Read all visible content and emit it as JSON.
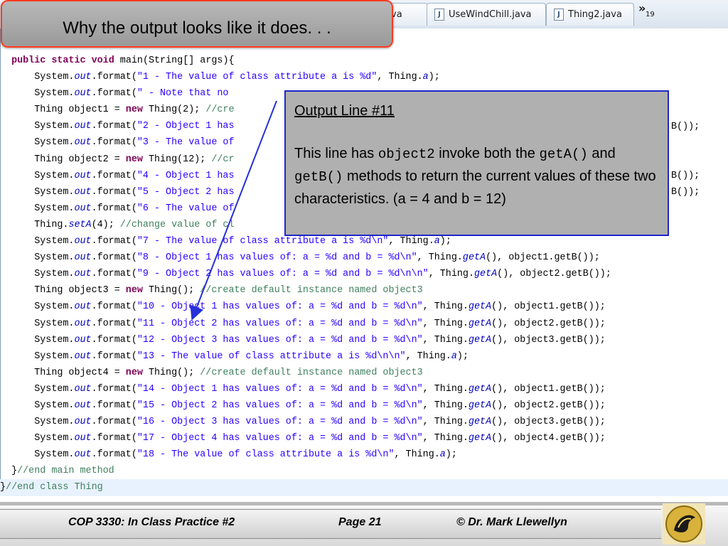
{
  "window": {
    "tabs": [
      {
        "label": "va"
      },
      {
        "label": "UseWindChill.java"
      },
      {
        "label": "Thing2.java"
      }
    ],
    "tab_overflow_count": "19"
  },
  "slide": {
    "title": "Why the output looks like it does. . ."
  },
  "callout": {
    "heading": "Output Line #11",
    "body": {
      "p1": "This line has ",
      "code1": "object2",
      "p2": " invoke both the ",
      "code2": "getA()",
      "p3": " and ",
      "code3": "getB()",
      "p4": " methods  to return the current values of these two characteristics. (a = 4 and b = 12)"
    }
  },
  "code_lines": [
    "  public static void main(String[] args){",
    "      System.out.format(\"1 - The value of class attribute a is %d\", Thing.a);",
    "      System.out.format(\" - Note that no",
    "      Thing object1 = new Thing(2); //cre",
    "      System.out.format(\"2 - Object 1 has",
    "      System.out.format(\"3 - The value of",
    "      Thing object2 = new Thing(12); //cr",
    "      System.out.format(\"4 - Object 1 has",
    "      System.out.format(\"5 - Object 2 has",
    "      System.out.format(\"6 - The value of",
    "      Thing.setA(4); //change value of cl",
    "      System.out.format(\"7 - The value of class attribute a is %d\\n\", Thing.a);",
    "      System.out.format(\"8 - Object 1 has values of: a = %d and b = %d\\n\", Thing.getA(), object1.getB());",
    "      System.out.format(\"9 - Object 2 has values of: a = %d and b = %d\\n\\n\", Thing.getA(), object2.getB());",
    "      Thing object3 = new Thing(); //create default instance named object3",
    "      System.out.format(\"10 - Object 1 has values of: a = %d and b = %d\\n\", Thing.getA(), object1.getB());",
    "      System.out.format(\"11 - Object 2 has values of: a = %d and b = %d\\n\", Thing.getA(), object2.getB());",
    "      System.out.format(\"12 - Object 3 has values of: a = %d and b = %d\\n\", Thing.getA(), object3.getB());",
    "      System.out.format(\"13 - The value of class attribute a is %d\\n\\n\", Thing.a);",
    "      Thing object4 = new Thing(); //create default instance named object3",
    "      System.out.format(\"14 - Object 1 has values of: a = %d and b = %d\\n\", Thing.getA(), object1.getB());",
    "      System.out.format(\"15 - Object 2 has values of: a = %d and b = %d\\n\", Thing.getA(), object2.getB());",
    "      System.out.format(\"16 - Object 3 has values of: a = %d and b = %d\\n\", Thing.getA(), object3.getB());",
    "      System.out.format(\"17 - Object 4 has values of: a = %d and b = %d\\n\", Thing.getA(), object4.getB());",
    "      System.out.format(\"18 - The value of class attribute a is %d\\n\", Thing.a);",
    "  }//end main method",
    "}//end class Thing"
  ],
  "right_fragments": [
    "B());",
    "B());",
    "B());"
  ],
  "footer": {
    "course": "COP 3330:  In Class Practice #2",
    "page": "Page 21",
    "author": "© Dr. Mark Llewellyn"
  },
  "colors": {
    "callout_border": "#1d27c9",
    "title_border": "#ff3b1f",
    "arrow": "#2530d8"
  }
}
